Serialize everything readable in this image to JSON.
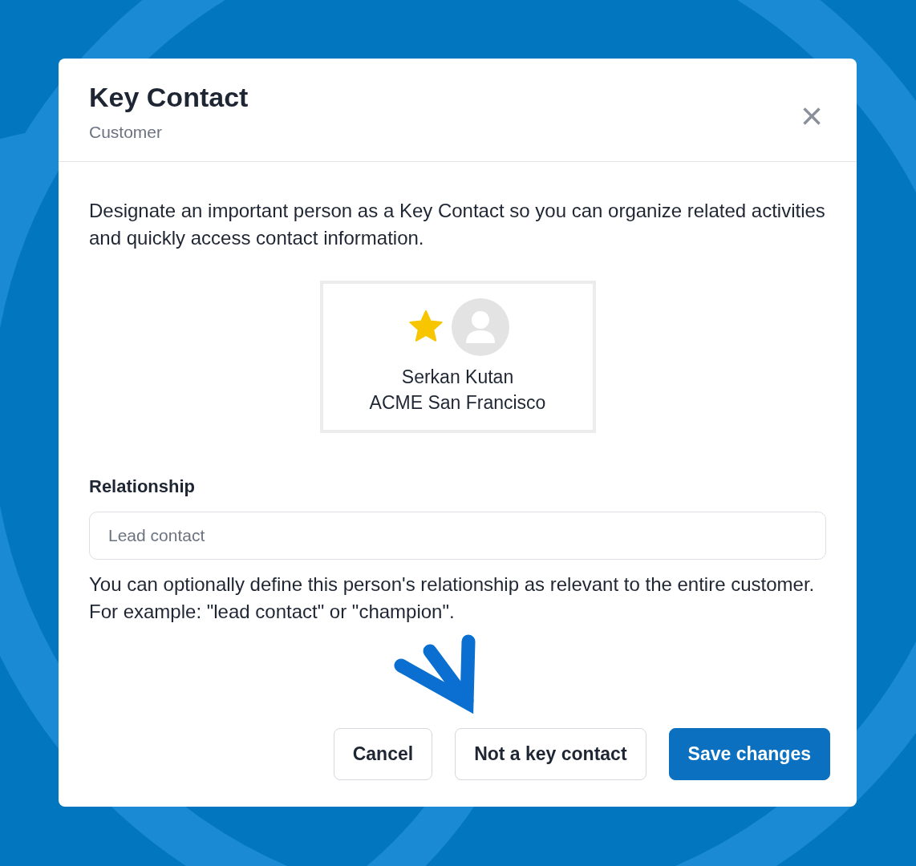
{
  "dialog": {
    "title": "Key Contact",
    "subtitle": "Customer",
    "close": "×",
    "description": "Designate an important person as a Key Contact so you can organize related activities and quickly access contact information.",
    "contact": {
      "starred": true,
      "name": "Serkan Kutan",
      "company": "ACME San Francisco"
    },
    "relationship": {
      "label": "Relationship",
      "placeholder": "Lead contact",
      "help": "You can optionally define this person's relationship as relevant to the entire customer. For example: \"lead contact\" or \"champion\"."
    },
    "buttons": [
      {
        "label": "Cancel",
        "kind": "secondary"
      },
      {
        "label": "Not a key contact",
        "kind": "secondary"
      },
      {
        "label": "Save changes",
        "kind": "primary"
      }
    ]
  }
}
